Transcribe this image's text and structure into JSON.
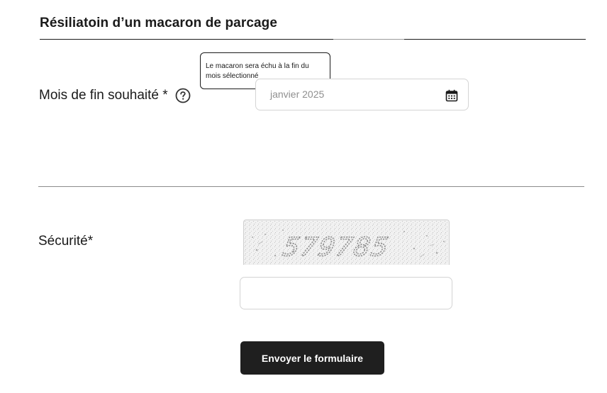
{
  "form": {
    "title": "Résiliatoin  d’un macaron de parcage",
    "end_month": {
      "label": "Mois de fin souhaité *",
      "help_icon": "question-circle-icon",
      "tooltip": "Le macaron sera échu à la fin du mois sélectionné",
      "value": "janvier 2025",
      "calendar_icon": "calendar-icon"
    },
    "security": {
      "label": "Sécurité*",
      "captcha_text": "579785",
      "input_value": ""
    },
    "submit_label": "Envoyer le formulaire"
  },
  "colors": {
    "text": "#1a1a1a",
    "button_bg": "#1f1f1f",
    "input_border": "#d4d4d4",
    "placeholder": "#8f8f8f"
  }
}
